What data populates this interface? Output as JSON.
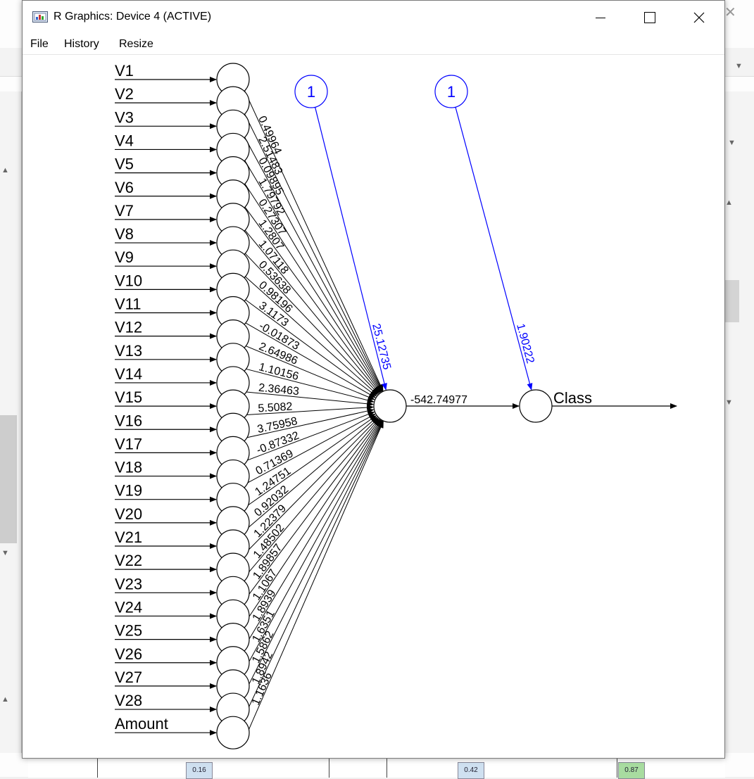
{
  "window": {
    "title": "R Graphics: Device 4 (ACTIVE)",
    "menu": [
      "File",
      "History",
      "Resize"
    ]
  },
  "network": {
    "inputs": [
      "V1",
      "V2",
      "V3",
      "V4",
      "V5",
      "V6",
      "V7",
      "V8",
      "V9",
      "V10",
      "V11",
      "V12",
      "V13",
      "V14",
      "V15",
      "V16",
      "V17",
      "V18",
      "V19",
      "V20",
      "V21",
      "V22",
      "V23",
      "V24",
      "V25",
      "V26",
      "V27",
      "V28",
      "Amount"
    ],
    "input_weights": [
      "0.49964",
      "2.51483",
      "0.09895",
      "1.79792",
      "0.27307",
      "1.2807",
      "1.07118",
      "0.53638",
      "0.98196",
      "3.1173",
      "-0.01873",
      "2.64986",
      "1.10156",
      "2.36463",
      "5.5082",
      "3.75958",
      "-0.87332",
      "0.71369",
      "1.24751",
      "0.92032",
      "1.22379",
      "1.48502",
      "1.89857",
      "1.1067",
      "1.8939",
      "1.6351",
      "1.5862",
      "1.8942",
      "1.1636"
    ],
    "bias_nodes": [
      "1",
      "1"
    ],
    "hidden_bias_weight": "25.12735",
    "output_bias_weight": "1.90222",
    "hidden_to_output_weight": "-542.74977",
    "output_label": "Class"
  },
  "background": {
    "chips": [
      "0.16",
      "0.42",
      "0.87"
    ],
    "chip_colors": [
      "#cfe0f0",
      "#cfe0f0",
      "#a8dca0"
    ]
  }
}
